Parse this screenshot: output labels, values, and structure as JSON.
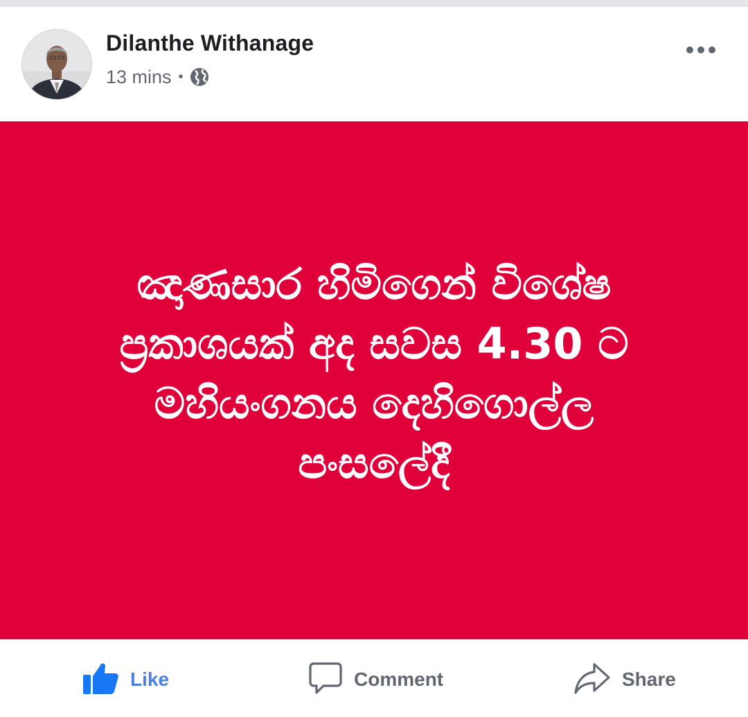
{
  "post": {
    "author": "Dilanthe Withanage",
    "timestamp": "13 mins",
    "separator": "•",
    "privacy_icon": "globe-icon",
    "more_icon": "more-options-icon",
    "body_text": "ඤාණසාර හිමිගෙන් විශේෂ\nප්‍රකාශයක් අද සවස 4.30 ට\nමහියංගනය දෙහිගොල්ල\nපංසලේදී",
    "background_color": "#e0003a",
    "text_color": "#ffffff"
  },
  "actions": {
    "like_label": "Like",
    "like_icon": "thumbs-up-icon",
    "like_color": "#4a7fe0",
    "comment_label": "Comment",
    "comment_icon": "comment-bubble-icon",
    "share_label": "Share",
    "share_icon": "share-arrow-icon"
  }
}
